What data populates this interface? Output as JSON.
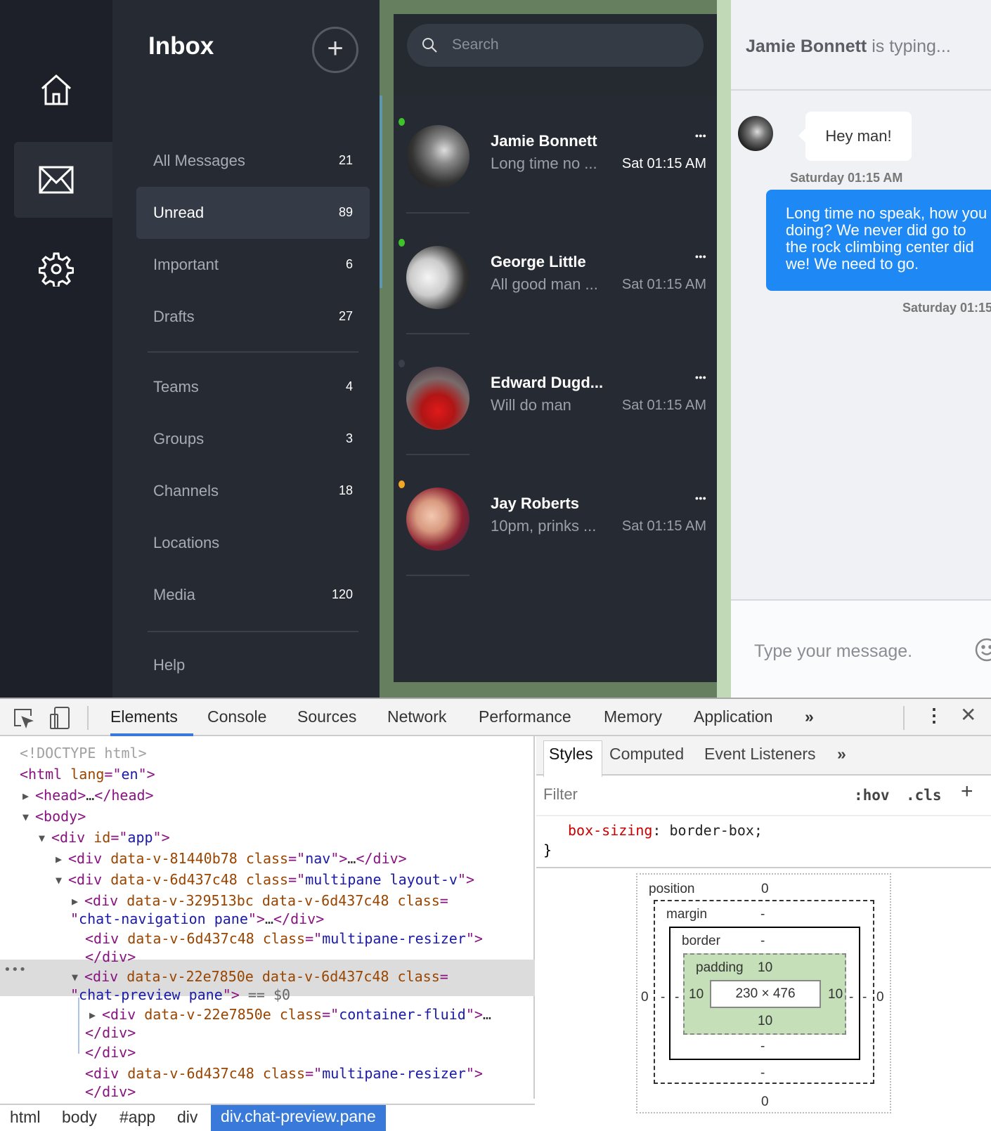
{
  "sidebar": {
    "icons": [
      "home-icon",
      "mail-icon",
      "gear-icon"
    ],
    "active": "mail-icon"
  },
  "nav": {
    "title": "Inbox",
    "add_label": "+",
    "items": [
      {
        "label": "All Messages",
        "count": "21"
      },
      {
        "label": "Unread",
        "count": "89",
        "active": true
      },
      {
        "label": "Important",
        "count": "6"
      },
      {
        "label": "Drafts",
        "count": "27"
      },
      {
        "label": "Teams",
        "count": "4"
      },
      {
        "label": "Groups",
        "count": "3"
      },
      {
        "label": "Channels",
        "count": "18"
      },
      {
        "label": "Locations",
        "count": ""
      },
      {
        "label": "Media",
        "count": "120"
      },
      {
        "label": "Help",
        "count": ""
      }
    ]
  },
  "search": {
    "placeholder": "Search"
  },
  "conversations": [
    {
      "name": "Jamie Bonnett",
      "preview": "Long time no ...",
      "time": "Sat 01:15 AM",
      "status": "#3fc32a",
      "unread": true
    },
    {
      "name": "George Little",
      "preview": "All good man ...",
      "time": "Sat 01:15 AM",
      "status": "#3fc32a",
      "unread": false
    },
    {
      "name": "Edward Dugd...",
      "preview": "Will do man",
      "time": "Sat 01:15 AM",
      "status": "#3a3f4a",
      "unread": false
    },
    {
      "name": "Jay Roberts",
      "preview": "10pm, prinks ...",
      "time": "Sat 01:15 AM",
      "status": "#f5a623",
      "unread": false
    }
  ],
  "chat": {
    "typing_name": "Jamie Bonnett",
    "typing_suffix": " is typing...",
    "messages": [
      {
        "text": "Hey man!",
        "time": "Saturday 01:15 AM",
        "from": "them"
      },
      {
        "text": "Long time no speak, how you doing? We never did go to the rock climbing center did we! We need to go.",
        "time": "Saturday 01:15",
        "from": "me"
      }
    ],
    "input_placeholder": "Type your message.",
    "accent": "#1e88f5"
  },
  "devtools": {
    "tabs": [
      "Elements",
      "Console",
      "Sources",
      "Network",
      "Performance",
      "Memory",
      "Application"
    ],
    "active_tab": "Elements",
    "more": "»",
    "dom_lines": [
      [
        [
          "gray",
          "<!DOCTYPE html>"
        ]
      ],
      [
        [
          "tag",
          "<html "
        ],
        [
          "attr",
          "lang"
        ],
        [
          "tag",
          "=\""
        ],
        [
          "val",
          "en"
        ],
        [
          "tag",
          "\">"
        ]
      ],
      [
        [
          "tag",
          "<head>"
        ],
        [
          "txt",
          "…"
        ],
        [
          "tag",
          "</head>"
        ]
      ],
      [
        [
          "tag",
          "<body>"
        ]
      ],
      [
        [
          "tag",
          "<div "
        ],
        [
          "attr",
          "id"
        ],
        [
          "tag",
          "=\""
        ],
        [
          "val",
          "app"
        ],
        [
          "tag",
          "\">"
        ]
      ],
      [
        [
          "tag",
          "<div "
        ],
        [
          "attr",
          "data-v-81440b78 class"
        ],
        [
          "tag",
          "=\""
        ],
        [
          "val",
          "nav"
        ],
        [
          "tag",
          "\">"
        ],
        [
          "txt",
          "…"
        ],
        [
          "tag",
          "</div>"
        ]
      ],
      [
        [
          "tag",
          "<div "
        ],
        [
          "attr",
          "data-v-6d437c48 class"
        ],
        [
          "tag",
          "=\""
        ],
        [
          "val",
          "multipane layout-v"
        ],
        [
          "tag",
          "\">"
        ]
      ],
      [
        [
          "tag",
          "<div "
        ],
        [
          "attr",
          "data-v-329513bc data-v-6d437c48 class"
        ],
        [
          "tag",
          "="
        ]
      ],
      [
        [
          "tag",
          "\""
        ],
        [
          "val",
          "chat-navigation pane"
        ],
        [
          "tag",
          "\">"
        ],
        [
          "txt",
          "…"
        ],
        [
          "tag",
          "</div>"
        ]
      ],
      [
        [
          "tag",
          "<div "
        ],
        [
          "attr",
          "data-v-6d437c48 class"
        ],
        [
          "tag",
          "=\""
        ],
        [
          "val",
          "multipane-resizer"
        ],
        [
          "tag",
          "\">"
        ]
      ],
      [
        [
          "tag",
          "</div>"
        ]
      ],
      [
        [
          "tag",
          "<div "
        ],
        [
          "attr",
          "data-v-22e7850e data-v-6d437c48 class"
        ],
        [
          "tag",
          "="
        ]
      ],
      [
        [
          "tag",
          "\""
        ],
        [
          "val",
          "chat-preview pane"
        ],
        [
          "tag",
          "\">"
        ],
        [
          "dim",
          " == $0"
        ]
      ],
      [
        [
          "tag",
          "<div "
        ],
        [
          "attr",
          "data-v-22e7850e class"
        ],
        [
          "tag",
          "=\""
        ],
        [
          "val",
          "container-fluid"
        ],
        [
          "tag",
          "\">"
        ],
        [
          "txt",
          "…"
        ]
      ],
      [
        [
          "tag",
          "</div>"
        ]
      ],
      [
        [
          "tag",
          "</div>"
        ]
      ],
      [
        [
          "tag",
          "<div "
        ],
        [
          "attr",
          "data-v-6d437c48 class"
        ],
        [
          "tag",
          "=\""
        ],
        [
          "val",
          "multipane-resizer"
        ],
        [
          "tag",
          "\">"
        ]
      ],
      [
        [
          "tag",
          "</div>"
        ]
      ]
    ],
    "breadcrumbs": [
      "html",
      "body",
      "#app",
      "div",
      "div.chat-preview.pane"
    ],
    "styles_tabs": [
      "Styles",
      "Computed",
      "Event Listeners"
    ],
    "filter_placeholder": "Filter",
    "hov": ":hov",
    "cls": ".cls",
    "css_prop": "box-sizing",
    "css_value": "border-box;",
    "brace": "}",
    "box_model": {
      "position_label": "position",
      "position": "0",
      "position_left": "0",
      "position_right": "0",
      "position_bottom": "0",
      "margin_label": "margin",
      "margin": "-",
      "border_label": "border",
      "border": "-",
      "padding_label": "padding",
      "padding": "10",
      "size": "230 × 476"
    }
  }
}
